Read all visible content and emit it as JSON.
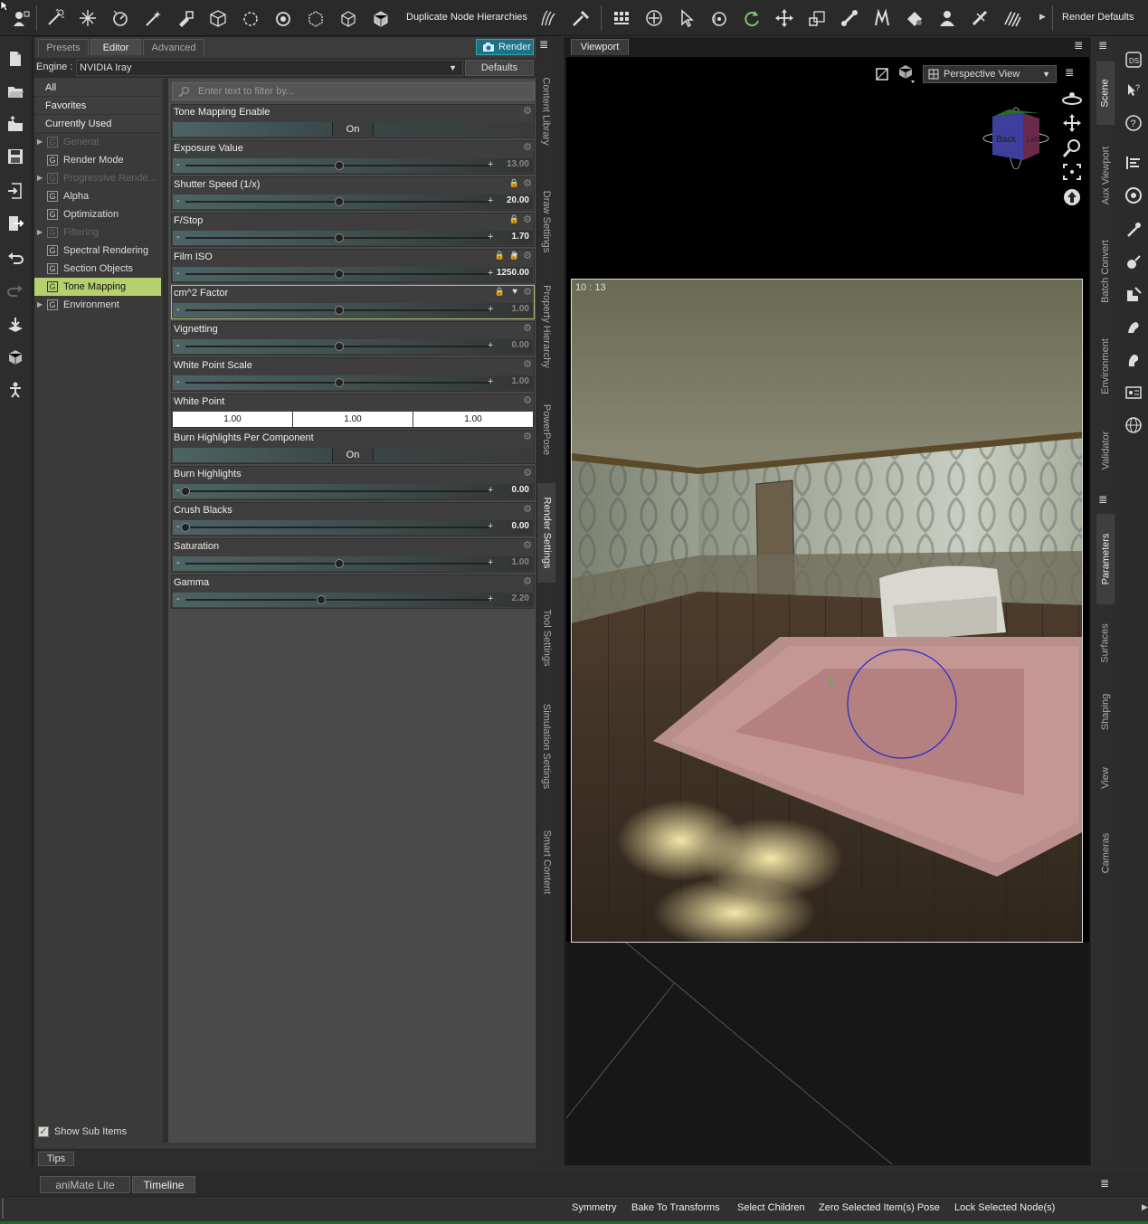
{
  "toolbar": {
    "duplicate_label": "Duplicate Node Hierarchies",
    "render_defaults_label": "Render Defaults"
  },
  "render_panel": {
    "tabs": [
      "Presets",
      "Editor",
      "Advanced"
    ],
    "render_button": "Render",
    "engine_label": "Engine :",
    "engine_value": "NVIDIA Iray",
    "defaults_button": "Defaults",
    "filter_placeholder": "Enter text to filter by...",
    "groups_top": [
      "All",
      "Favorites",
      "Currently Used"
    ],
    "groups": [
      {
        "label": "General",
        "disabled": true,
        "expandable": true
      },
      {
        "label": "Render Mode",
        "disabled": false,
        "expandable": false
      },
      {
        "label": "Progressive Rende...",
        "disabled": true,
        "expandable": true
      },
      {
        "label": "Alpha",
        "disabled": false,
        "expandable": false
      },
      {
        "label": "Optimization",
        "disabled": false,
        "expandable": false
      },
      {
        "label": "Filtering",
        "disabled": true,
        "expandable": true
      },
      {
        "label": "Spectral Rendering",
        "disabled": false,
        "expandable": false
      },
      {
        "label": "Section Objects",
        "disabled": false,
        "expandable": false
      },
      {
        "label": "Tone Mapping",
        "disabled": false,
        "expandable": false,
        "selected": true
      },
      {
        "label": "Environment",
        "disabled": false,
        "expandable": true
      }
    ],
    "group_box_letter": "G",
    "params": [
      {
        "label": "Tone Mapping Enable",
        "type": "toggle",
        "value": "On"
      },
      {
        "label": "Exposure Value",
        "type": "slider",
        "value": "13.00",
        "level": 0.5,
        "active": false
      },
      {
        "label": "Shutter Speed (1/x)",
        "type": "slider",
        "value": "20.00",
        "level": 0.5,
        "active": true
      },
      {
        "label": "F/Stop",
        "type": "slider",
        "value": "1.70",
        "level": 0.5,
        "active": true
      },
      {
        "label": "Film ISO",
        "type": "slider",
        "value": "1250.00",
        "level": 0.5,
        "active": true
      },
      {
        "label": "cm^2 Factor",
        "type": "slider",
        "value": "1.00",
        "level": 0.5,
        "active": false,
        "highlight": true
      },
      {
        "label": "Vignetting",
        "type": "slider",
        "value": "0.00",
        "level": 0.5,
        "active": false
      },
      {
        "label": "White Point Scale",
        "type": "slider",
        "value": "1.00",
        "level": 0.5,
        "active": false
      },
      {
        "label": "White Point",
        "type": "color",
        "values": [
          "1.00",
          "1.00",
          "1.00"
        ]
      },
      {
        "label": "Burn Highlights Per Component",
        "type": "toggle",
        "value": "On"
      },
      {
        "label": "Burn Highlights",
        "type": "slider",
        "value": "0.00",
        "level": 0.0,
        "active": true
      },
      {
        "label": "Crush Blacks",
        "type": "slider",
        "value": "0.00",
        "level": 0.0,
        "active": true
      },
      {
        "label": "Saturation",
        "type": "slider",
        "value": "1.00",
        "level": 0.5,
        "active": false
      },
      {
        "label": "Gamma",
        "type": "slider",
        "value": "2.20",
        "level": 0.44,
        "active": false
      }
    ],
    "show_sub_items": "Show Sub Items",
    "tips_tab": "Tips"
  },
  "vertical_tabs": [
    "Content Library",
    "Draw Settings",
    "Property Hierarchy",
    "PowerPose",
    "Render Settings",
    "Tool Settings",
    "Simulation Settings",
    "Smart Content"
  ],
  "viewport": {
    "tab": "Viewport",
    "camera_select": "Perspective View",
    "render_time": "10 : 13",
    "cube_labels": [
      "Back",
      "Left"
    ]
  },
  "right_tabs": [
    "Scene",
    "Aux Viewport",
    "Batch Convert",
    "Environment",
    "Validator",
    "Parameters",
    "Surfaces",
    "Shaping",
    "View",
    "Cameras"
  ],
  "right_icons": [
    "ds-logo-icon",
    "help-cursor-icon",
    "question-icon",
    "align-icon",
    "target-icon",
    "pose-tool-icon",
    "morph-icon",
    "figure-edit-icon",
    "muscle-icon",
    "arm-icon",
    "id-card-icon",
    "globe-icon"
  ],
  "bottom_tabs": [
    "aniMate Lite",
    "Timeline"
  ],
  "bottom_actions": [
    "Symmetry",
    "Bake To Transforms",
    "Select Children",
    "Zero Selected Item(s) Pose",
    "Lock Selected Node(s)"
  ],
  "colors": {
    "selected_group": "#b6cf6f",
    "render_button": "#1f6f85",
    "status_green": "#1c6a2a"
  }
}
